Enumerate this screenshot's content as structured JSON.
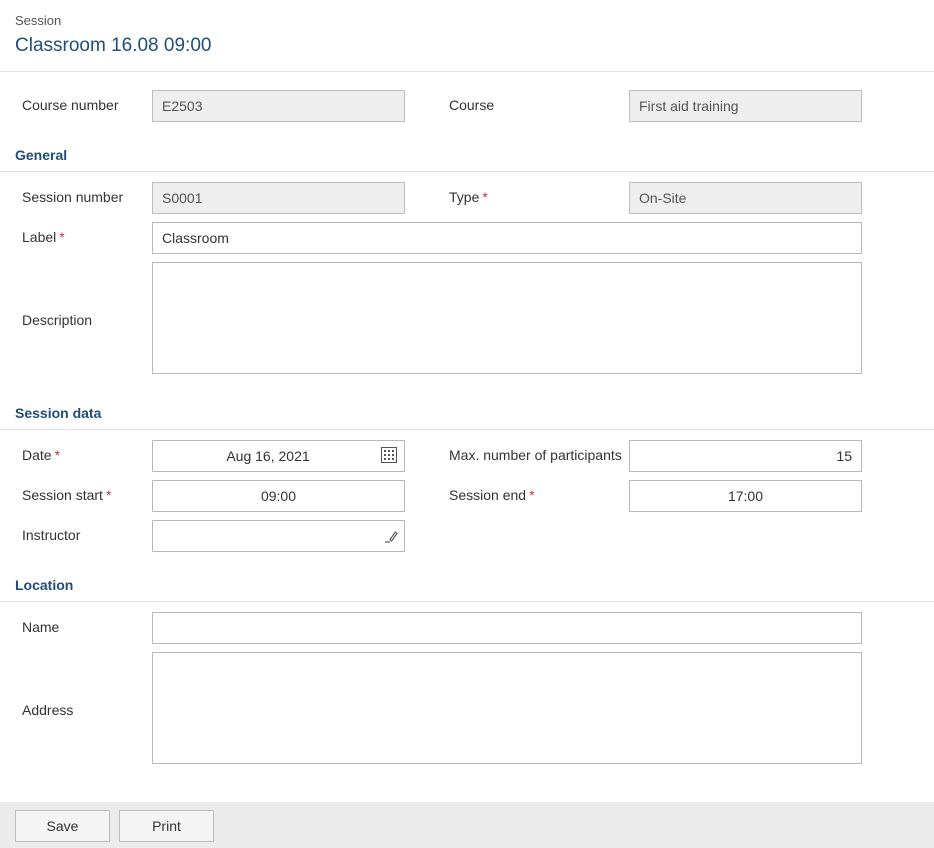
{
  "header": {
    "breadcrumb": "Session",
    "title": "Classroom 16.08 09:00"
  },
  "course": {
    "course_number_label": "Course number",
    "course_number_value": "E2503",
    "course_label": "Course",
    "course_value": "First aid training"
  },
  "general": {
    "section_title": "General",
    "session_number_label": "Session number",
    "session_number_value": "S0001",
    "type_label": "Type",
    "type_value": "On-Site",
    "label_label": "Label",
    "label_value": "Classroom",
    "description_label": "Description",
    "description_value": ""
  },
  "session_data": {
    "section_title": "Session data",
    "date_label": "Date",
    "date_value": "Aug 16, 2021",
    "max_participants_label": "Max. number of participants",
    "max_participants_value": "15",
    "session_start_label": "Session start",
    "session_start_value": "09:00",
    "session_end_label": "Session end",
    "session_end_value": "17:00",
    "instructor_label": "Instructor",
    "instructor_value": ""
  },
  "location": {
    "section_title": "Location",
    "name_label": "Name",
    "name_value": "",
    "address_label": "Address",
    "address_value": ""
  },
  "footer": {
    "save_label": "Save",
    "print_label": "Print"
  },
  "required_marker": "*",
  "colors": {
    "accent": "#1f4e79",
    "required": "#c0392b",
    "readonly_bg": "#eeeeee",
    "footer_bg": "#ebebeb"
  },
  "icons": {
    "date_picker": "calendar-icon",
    "instructor_picker": "edit-icon"
  }
}
